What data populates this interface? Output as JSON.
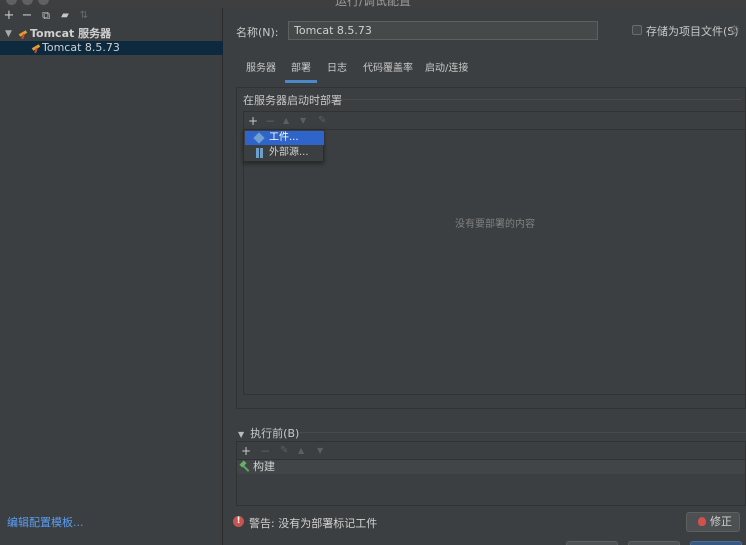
{
  "window": {
    "title": "运行/调试配置"
  },
  "left_toolbar": {
    "add": "+",
    "remove": "−",
    "copy": "⧉",
    "folder": "▰",
    "sort": "⇅"
  },
  "tree": {
    "group": {
      "label": "Tomcat 服务器"
    },
    "item": {
      "label": "Tomcat 8.5.73"
    }
  },
  "edit_templates_link": "编辑配置模板...",
  "name_field": {
    "label": "名称(N):",
    "value": "Tomcat 8.5.73"
  },
  "store_as_project_file": {
    "label": "存储为项目文件(S)",
    "checked": false
  },
  "tabs": [
    {
      "label": "服务器"
    },
    {
      "label": "部署"
    },
    {
      "label": "日志"
    },
    {
      "label": "代码覆盖率"
    },
    {
      "label": "启动/连接"
    }
  ],
  "active_tab": "部署",
  "deploy": {
    "heading": "在服务器启动时部署",
    "empty_text": "没有要部署的内容",
    "toolbar": {
      "add": "+",
      "remove": "−",
      "up": "▲",
      "down": "▼",
      "edit": "✎"
    }
  },
  "popup_menu": {
    "items": [
      {
        "label": "工件...",
        "highlighted": true
      },
      {
        "label": "外部源...",
        "highlighted": false
      }
    ]
  },
  "before_launch": {
    "heading": "执行前(B)",
    "toolbar": {
      "add": "+",
      "remove": "−",
      "edit": "✎",
      "up": "▲",
      "down": "▼"
    },
    "tasks": [
      {
        "label": "构建"
      }
    ]
  },
  "warning": {
    "icon_text": "!",
    "text": "警告: 没有为部署标记工件"
  },
  "fix_button": {
    "label": "修正"
  },
  "colors": {
    "background": "#3c3f41",
    "selection": "#0d293e",
    "tab_underline": "#4a88c7",
    "popup_highlight": "#2f65ca",
    "link": "#589df6",
    "error": "#c75450"
  }
}
